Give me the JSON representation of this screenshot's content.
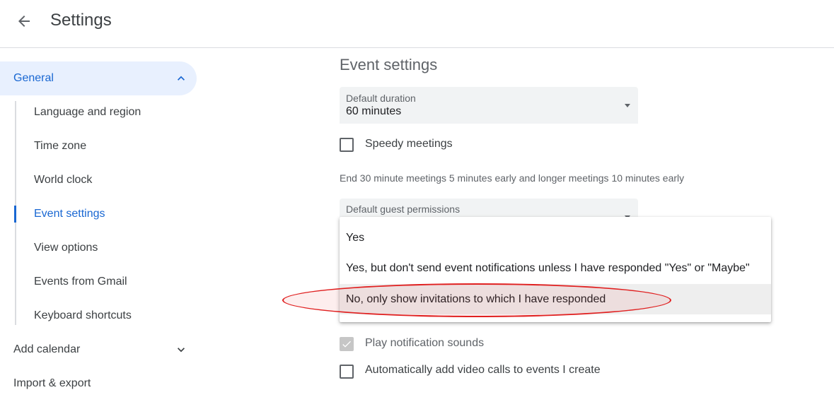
{
  "header": {
    "title": "Settings",
    "back_icon": "arrow-back-icon"
  },
  "sidebar": {
    "general": {
      "label": "General",
      "icon": "chevron-up-icon"
    },
    "items": [
      {
        "label": "Language and region"
      },
      {
        "label": "Time zone"
      },
      {
        "label": "World clock"
      },
      {
        "label": "Event settings",
        "active": true
      },
      {
        "label": "View options"
      },
      {
        "label": "Events from Gmail"
      },
      {
        "label": "Keyboard shortcuts"
      }
    ],
    "add_calendar": {
      "label": "Add calendar",
      "icon": "chevron-down-icon"
    },
    "import_export": {
      "label": "Import & export"
    }
  },
  "main": {
    "section_title": "Event settings",
    "default_duration": {
      "label": "Default duration",
      "value": "60 minutes"
    },
    "speedy_meetings": {
      "label": "Speedy meetings",
      "checked": false
    },
    "speedy_helper": "End 30 minute meetings 5 minutes early and longer meetings 10 minutes early",
    "guest_permissions": {
      "label": "Default guest permissions"
    },
    "play_sounds": {
      "label": "Play notification sounds",
      "checked": true,
      "disabled": true
    },
    "auto_video": {
      "label": "Automatically add video calls to events I create",
      "checked": false
    }
  },
  "dropdown": {
    "options": [
      {
        "label": "Yes"
      },
      {
        "label": "Yes, but don't send event notifications unless I have responded \"Yes\" or \"Maybe\""
      },
      {
        "label": "No, only show invitations to which I have responded",
        "highlighted": true
      }
    ]
  },
  "colors": {
    "accent": "#1967d2",
    "nav_active_bg": "#e8f0fe",
    "annotation": "#e02020"
  }
}
